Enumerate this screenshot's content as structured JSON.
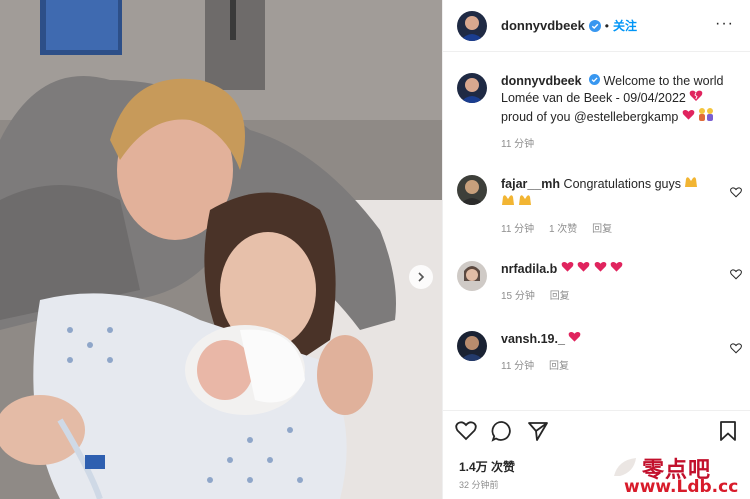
{
  "header": {
    "username": "donnyvdbeek",
    "separator": "•",
    "follow_label": "关注",
    "more_label": "···"
  },
  "caption": {
    "username": "donnyvdbeek",
    "line1": "Welcome to the world",
    "line2": "Lomée van de Beek - 09/04/2022",
    "line3": "proud of you @estellebergkamp",
    "time": "11 分钟"
  },
  "comments": [
    {
      "username": "fajar__mh",
      "text": "Congratulations guys",
      "time": "11 分钟",
      "likes": "1 次赞",
      "reply": "回复"
    },
    {
      "username": "nrfadila.b",
      "text": "",
      "time": "15 分钟",
      "reply": "回复"
    },
    {
      "username": "vansh.19._",
      "text": "",
      "time": "11 分钟",
      "reply": "回复"
    }
  ],
  "footer": {
    "likes": "1.4万 次赞",
    "time": "32 分钟前"
  },
  "watermark": {
    "cn": "零点吧",
    "url": "www.Ldb.cc"
  },
  "icons": {
    "verified": "verified-badge-icon",
    "like": "heart-outline-icon",
    "comment": "speech-bubble-icon",
    "share": "paper-plane-icon",
    "save": "bookmark-icon",
    "next": "chevron-right-icon"
  },
  "colors": {
    "link": "#0095f6",
    "heart_red": "#e0245e",
    "muted": "#8e8e8e"
  }
}
